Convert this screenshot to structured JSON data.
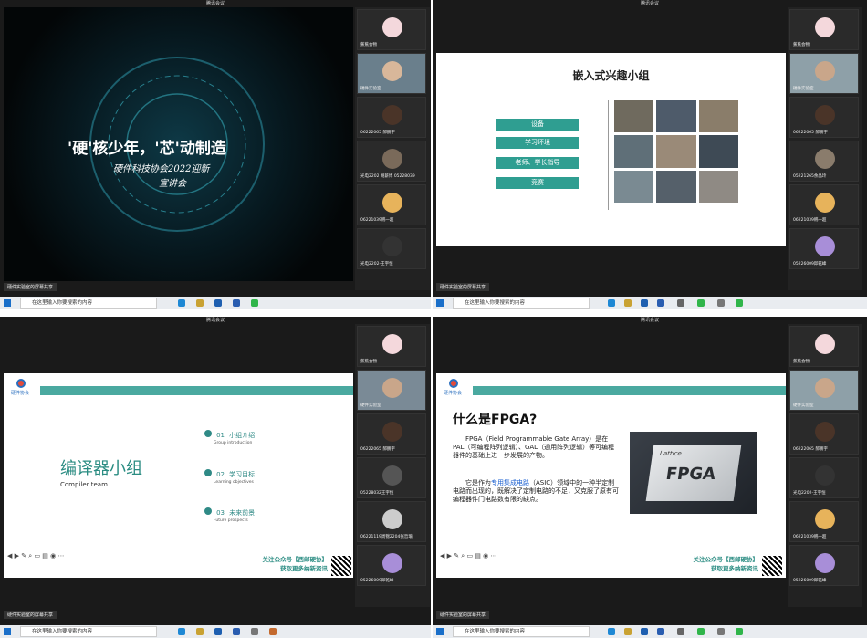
{
  "window_title": "腾讯会议",
  "share_text": "硬件实验室的屏幕共享",
  "taskbar_search": "在这里输入你要搜索的内容",
  "q1": {
    "line1": "'硬'核少年，'芯'动制造",
    "line2": "硬件科技协会2022迎新",
    "line3": "宣讲会"
  },
  "q2": {
    "title": "嵌入式兴趣小组",
    "buttons": [
      "设备",
      "学习环境",
      "老师、学长指导",
      "竞赛"
    ]
  },
  "q3": {
    "logo_text": "硬件协会",
    "title": "编译器小组",
    "subtitle": "Compiler team",
    "items": [
      {
        "num": "01",
        "cn": "小组介绍",
        "en": "Group introduction"
      },
      {
        "num": "02",
        "cn": "学习目标",
        "en": "Learning objectives"
      },
      {
        "num": "03",
        "cn": "未来前景",
        "en": "Future prospects"
      }
    ],
    "footer1": "关注公众号【西邮硬协】",
    "footer2": "获取更多纳新资讯"
  },
  "q4": {
    "logo_text": "硬件协会",
    "title": "什么是FPGA?",
    "para1": "FPGA（Field Programmable Gate Array）是在PAL（可编程阵列逻辑）、GAL（通用阵列逻辑）等可编程器件的基础上进一步发展的产物。",
    "para2_pre": "它是作为",
    "para2_link": "专用集成电路",
    "para2_post": "（ASIC）领域中的一种半定制电路而出现的，既解决了定制电路的不足，又克服了原有可编程器件门电路数有限的缺点。",
    "chip_brand": "Lattice",
    "chip_text": "FPGA",
    "footer1": "关注公众号【西邮硬协】",
    "footer2": "获取更多纳新资讯"
  },
  "participants": {
    "q1": [
      "蕉蕉会物",
      "硬件实验室",
      "06222065 郝鹏宇",
      "光电2202 胡薪博 05228039",
      "06221039韩一超",
      "光电2202-王宇恒"
    ],
    "q2": [
      "蕉蕉会物",
      "硬件实验室",
      "06222065 郝鹏宇",
      "05221265余晶玲",
      "06221039韩一超",
      "05226009邱乾峰"
    ],
    "q3": [
      "蕉蕉会物",
      "硬件实验室",
      "06222065 郝鹏宇",
      "05228032王宇恒",
      "06221119周锦2204张哲瑜",
      "05226009邱乾峰"
    ],
    "q4": [
      "蕉蕉会物",
      "硬件实验室",
      "06222065 郝鹏宇",
      "光电2202-王宇恒",
      "06221039韩一超",
      "05226009邱乾峰"
    ]
  }
}
